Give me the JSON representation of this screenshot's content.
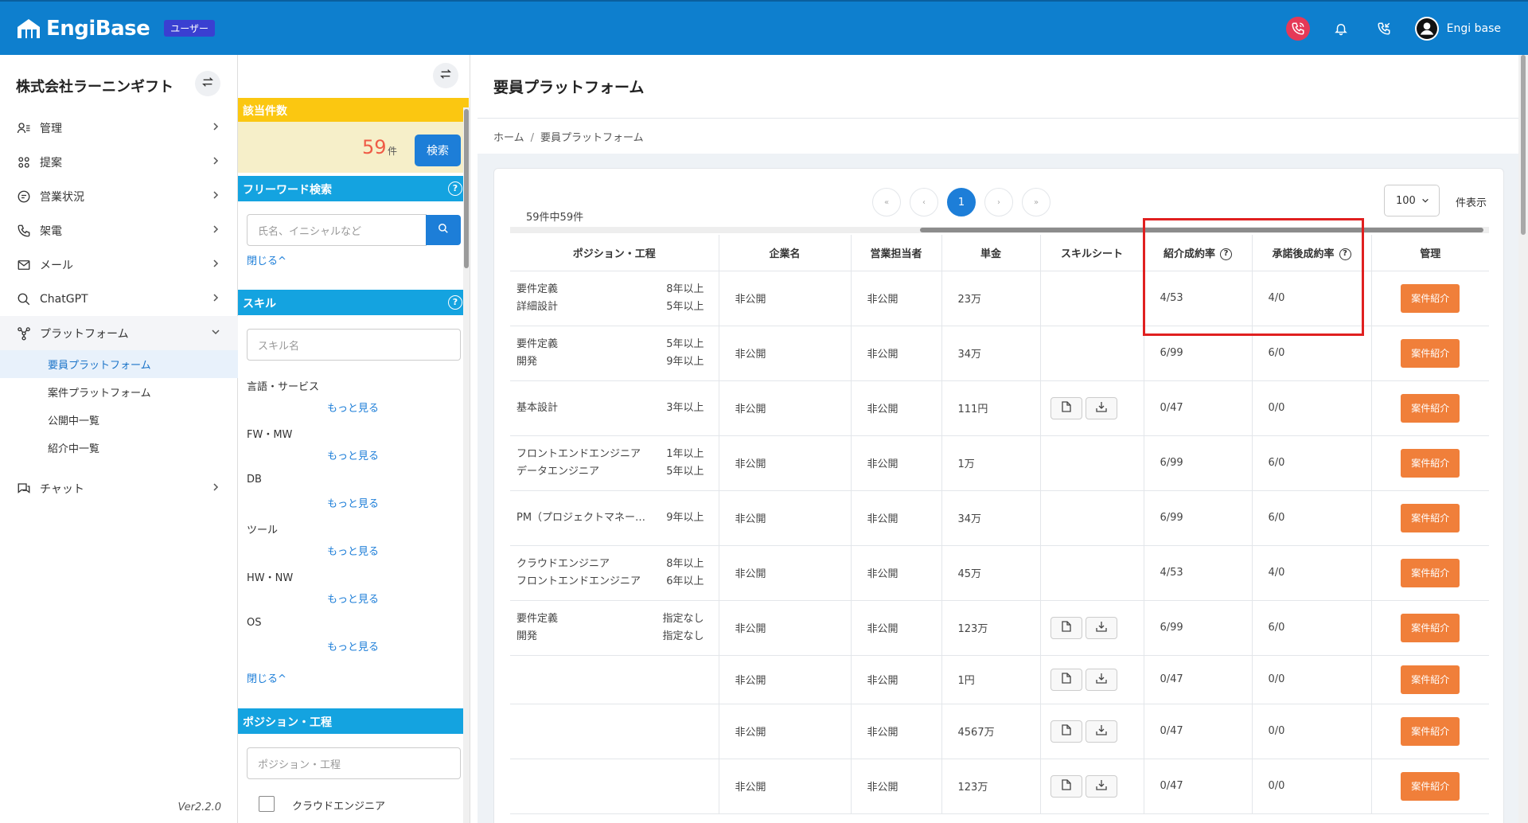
{
  "header": {
    "logo_text": "EngiBase",
    "role_badge": "ユーザー",
    "user_name": "Engi base",
    "icons": [
      "phone-call-icon",
      "bell-icon",
      "phone-incoming-icon",
      "user-avatar-icon"
    ]
  },
  "sidebar": {
    "company": "株式会社ラーニンギフト",
    "items": [
      {
        "label": "管理",
        "icon": "user-list-icon"
      },
      {
        "label": "提案",
        "icon": "team-icon"
      },
      {
        "label": "営業状況",
        "icon": "chat-bubble-icon"
      },
      {
        "label": "架電",
        "icon": "phone-icon"
      },
      {
        "label": "メール",
        "icon": "mail-icon"
      },
      {
        "label": "ChatGPT",
        "icon": "search-icon"
      },
      {
        "label": "プラットフォーム",
        "icon": "network-icon"
      },
      {
        "label": "チャット",
        "icon": "chat-icon"
      }
    ],
    "platform_sub": [
      "要員プラットフォーム",
      "案件プラットフォーム",
      "公開中一覧",
      "紹介中一覧"
    ],
    "version": "Ver2.2.0"
  },
  "filter": {
    "count_title": "該当件数",
    "count": "59",
    "count_unit": "件",
    "search_label": "検索",
    "keyword_title": "フリーワード検索",
    "keyword_placeholder": "氏名、イニシャルなど",
    "close_label": "閉じる^",
    "skill_title": "スキル",
    "skill_placeholder": "スキル名",
    "skill_categories": [
      "言語・サービス",
      "FW・MW",
      "DB",
      "ツール",
      "HW・NW",
      "OS"
    ],
    "more_label": "もっと見る",
    "close_label2": "閉じる^",
    "position_title": "ポジション・工程",
    "position_placeholder": "ポジション・工程",
    "position_option": "クラウドエンジニア"
  },
  "main": {
    "title": "要員プラットフォーム",
    "breadcrumb_home": "ホーム",
    "breadcrumb_current": "要員プラットフォーム",
    "total_text": "59件中59件",
    "pager": [
      "«",
      "‹",
      "1",
      "›",
      "»"
    ],
    "per_page": "100",
    "per_page_suffix": "件表示",
    "columns": [
      "ポジション・工程",
      "企業名",
      "営業担当者",
      "単金",
      "スキルシート",
      "紹介成約率",
      "承諾後成約率",
      "管理"
    ],
    "intro_label": "案件紹介",
    "rows": [
      {
        "pos": [
          [
            "要件定義",
            "8年以上"
          ],
          [
            "詳細設計",
            "5年以上"
          ]
        ],
        "company": "非公開",
        "sales": "非公開",
        "price": "23万",
        "sheet": false,
        "rate1": "4/53",
        "rate2": "4/0"
      },
      {
        "pos": [
          [
            "要件定義",
            "5年以上"
          ],
          [
            "開発",
            "9年以上"
          ]
        ],
        "company": "非公開",
        "sales": "非公開",
        "price": "34万",
        "sheet": false,
        "rate1": "6/99",
        "rate2": "6/0"
      },
      {
        "pos": [
          [
            "基本設計",
            "3年以上"
          ]
        ],
        "company": "非公開",
        "sales": "非公開",
        "price": "111円",
        "sheet": true,
        "rate1": "0/47",
        "rate2": "0/0"
      },
      {
        "pos": [
          [
            "フロントエンドエンジニア",
            "1年以上"
          ],
          [
            "データエンジニア",
            "5年以上"
          ]
        ],
        "company": "非公開",
        "sales": "非公開",
        "price": "1万",
        "sheet": false,
        "rate1": "6/99",
        "rate2": "6/0"
      },
      {
        "pos": [
          [
            "PM（プロジェクトマネー…",
            "9年以上"
          ]
        ],
        "company": "非公開",
        "sales": "非公開",
        "price": "34万",
        "sheet": false,
        "rate1": "6/99",
        "rate2": "6/0"
      },
      {
        "pos": [
          [
            "クラウドエンジニア",
            "8年以上"
          ],
          [
            "フロントエンドエンジニア",
            "6年以上"
          ]
        ],
        "company": "非公開",
        "sales": "非公開",
        "price": "45万",
        "sheet": false,
        "rate1": "4/53",
        "rate2": "4/0"
      },
      {
        "pos": [
          [
            "要件定義",
            "指定なし"
          ],
          [
            "開発",
            "指定なし"
          ]
        ],
        "company": "非公開",
        "sales": "非公開",
        "price": "123万",
        "sheet": true,
        "rate1": "6/99",
        "rate2": "6/0"
      },
      {
        "pos": [],
        "company": "非公開",
        "sales": "非公開",
        "price": "1円",
        "sheet": true,
        "rate1": "0/47",
        "rate2": "0/0"
      },
      {
        "pos": [],
        "company": "非公開",
        "sales": "非公開",
        "price": "4567万",
        "sheet": true,
        "rate1": "0/47",
        "rate2": "0/0"
      },
      {
        "pos": [],
        "company": "非公開",
        "sales": "非公開",
        "price": "123万",
        "sheet": true,
        "rate1": "0/47",
        "rate2": "0/0"
      }
    ]
  },
  "colors": {
    "header": "#0e7fce",
    "accent": "#1d7ed8",
    "count_head": "#fbc711",
    "section_head": "#14a3e0",
    "intro_button": "#f07f3a",
    "highlight": "#e02020"
  }
}
